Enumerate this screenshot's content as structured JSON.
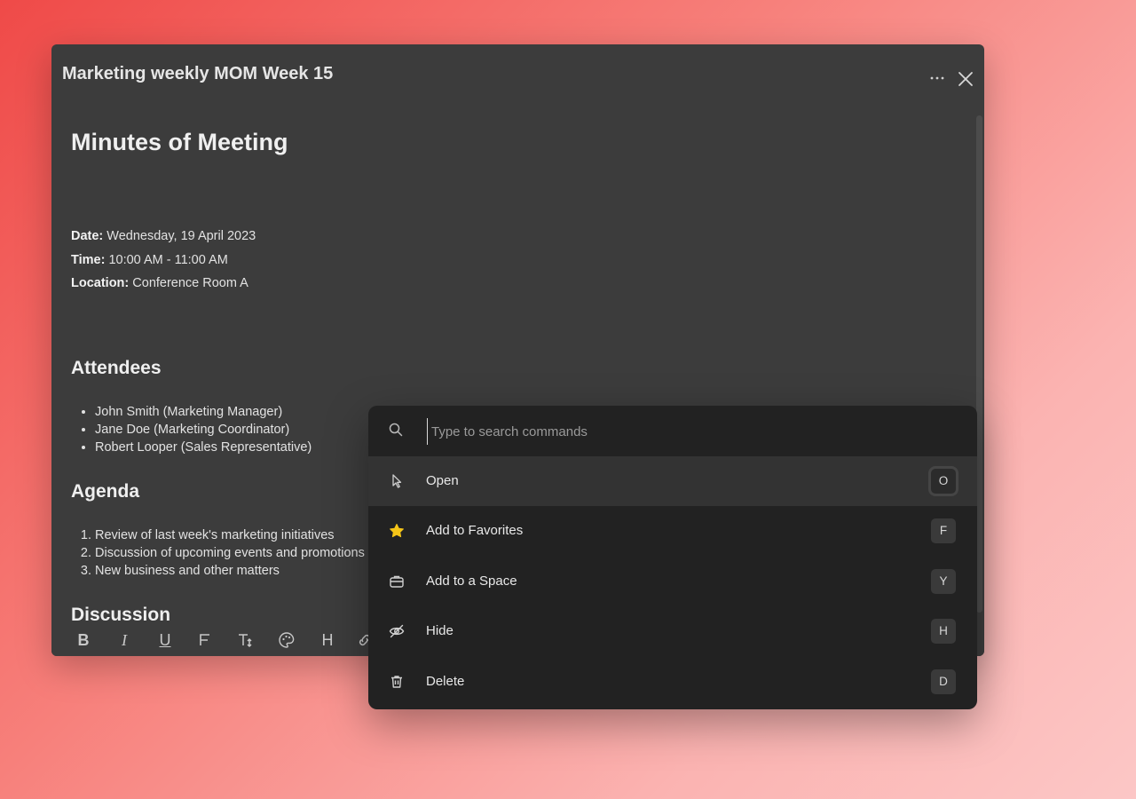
{
  "window": {
    "title": "Marketing weekly MOM Week 15",
    "menu_icon": "ellipsis-icon",
    "close_icon": "close-icon"
  },
  "document": {
    "heading": "Minutes of Meeting",
    "meta": [
      {
        "label": "Date:",
        "value": " Wednesday, 19 April 2023"
      },
      {
        "label": "Time:",
        "value": " 10:00 AM - 11:00 AM"
      },
      {
        "label": "Location:",
        "value": " Conference Room A"
      }
    ],
    "attendees_heading": "Attendees",
    "attendees": [
      "John Smith (Marketing Manager)",
      "Jane Doe (Marketing Coordinator)",
      "Robert Looper (Sales Representative)"
    ],
    "agenda_heading": "Agenda",
    "agenda": [
      "Review of last week's marketing initiatives",
      "Discussion of upcoming events and promotions",
      "New business and other matters"
    ],
    "discussion_heading": "Discussion"
  },
  "toolbar": {
    "bold": "B",
    "italic": "I",
    "underline": "U",
    "heading": "H"
  },
  "palette": {
    "search_placeholder": "Type to search commands",
    "commands": [
      {
        "label": "Open",
        "shortcut": "O",
        "icon": "cursor-arrow-icon",
        "active": true
      },
      {
        "label": "Add to Favorites",
        "shortcut": "F",
        "icon": "star-icon",
        "icon_color": "#f5c518"
      },
      {
        "label": "Add to a Space",
        "shortcut": "Y",
        "icon": "briefcase-icon"
      },
      {
        "label": "Hide",
        "shortcut": "H",
        "icon": "eye-off-icon"
      },
      {
        "label": "Delete",
        "shortcut": "D",
        "icon": "trash-icon"
      }
    ]
  }
}
